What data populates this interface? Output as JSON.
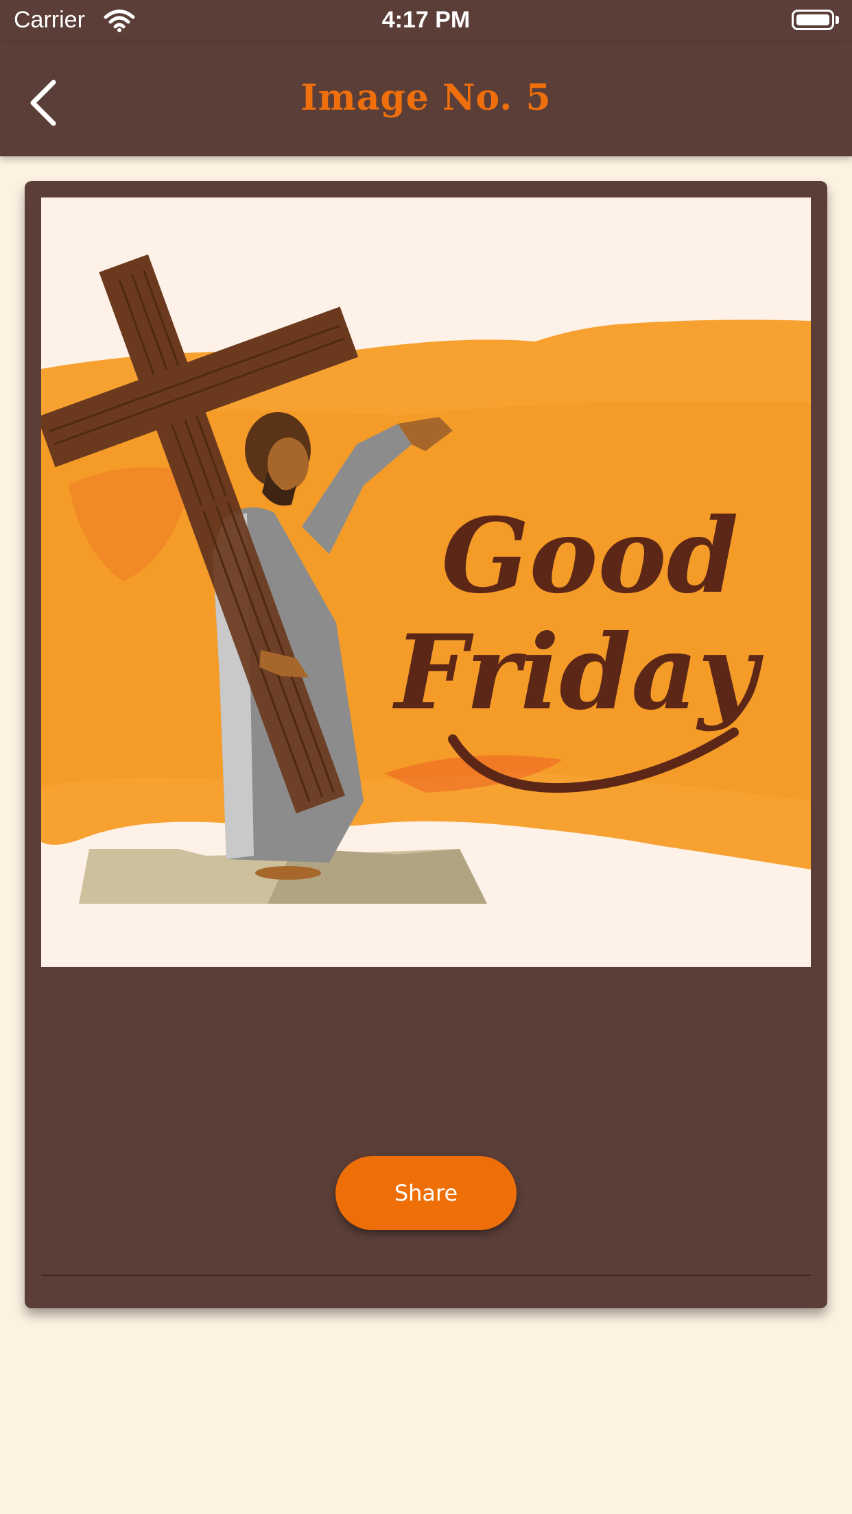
{
  "status_bar": {
    "carrier": "Carrier",
    "time": "4:17 PM"
  },
  "nav": {
    "title": "Image No. 5",
    "back_icon": "chevron-left-icon",
    "title_color": "#ef6f0c"
  },
  "image": {
    "lettering_line1": "Good",
    "lettering_line2": "Friday"
  },
  "actions": {
    "share_label": "Share"
  },
  "colors": {
    "bar_background": "#5a3e37",
    "page_background": "#fdf1e1",
    "accent": "#ee6e07"
  }
}
